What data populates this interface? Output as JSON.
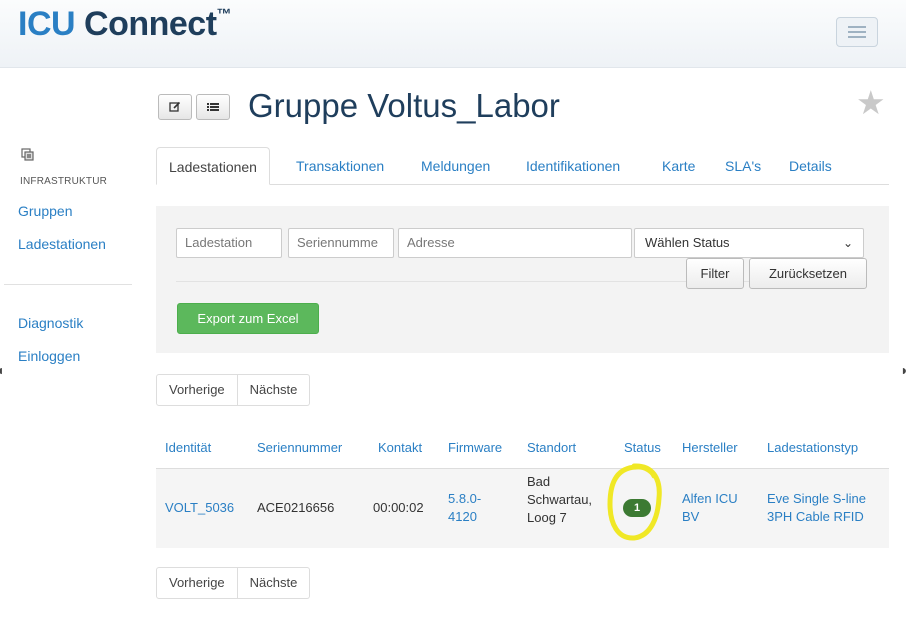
{
  "header": {
    "logo_icu": "ICU",
    "logo_connect": "Connect",
    "logo_tm": "™"
  },
  "sidebar": {
    "section_label": "INFRASTRUKTUR",
    "items": [
      {
        "label": "Gruppen"
      },
      {
        "label": "Ladestationen"
      },
      {
        "label": "Diagnostik"
      },
      {
        "label": "Einloggen"
      }
    ]
  },
  "title": {
    "text": "Gruppe Voltus_Labor",
    "edit_icon": "edit-icon",
    "list_icon": "list-icon"
  },
  "tabs": [
    {
      "label": "Ladestationen",
      "active": true
    },
    {
      "label": "Transaktionen"
    },
    {
      "label": "Meldungen"
    },
    {
      "label": "Identifikationen"
    },
    {
      "label": "Karte"
    },
    {
      "label": "SLA's"
    },
    {
      "label": "Details"
    }
  ],
  "filter": {
    "station_placeholder": "Ladestation",
    "serial_placeholder": "Seriennumme",
    "address_placeholder": "Adresse",
    "status_select": "Wählen Status",
    "filter_button": "Filter",
    "reset_button": "Zurücksetzen",
    "export_button": "Export zum Excel"
  },
  "pager": {
    "prev": "Vorherige",
    "next": "Nächste"
  },
  "table": {
    "headers": [
      "Identität",
      "Seriennummer",
      "Kontakt",
      "Firmware",
      "Standort",
      "Status",
      "Hersteller",
      "Ladestationstyp"
    ],
    "rows": [
      {
        "identity": "VOLT_5036",
        "serial": "ACE0216656",
        "contact": "00:00:02",
        "firmware_1": "5.8.0-",
        "firmware_2": "4120",
        "location_1": "Bad",
        "location_2": "Schwartau,",
        "location_3": "Loog 7",
        "status": "1",
        "manufacturer_1": "Alfen ICU",
        "manufacturer_2": "BV",
        "type_1": "Eve Single S-line",
        "type_2": "3PH Cable RFID"
      }
    ]
  },
  "colors": {
    "brand_blue": "#2a7fc4",
    "brand_dark": "#1f3e5c",
    "export_green": "#5cb85c",
    "status_badge": "#3c7a33",
    "highlight_yellow": "#f0e826"
  }
}
